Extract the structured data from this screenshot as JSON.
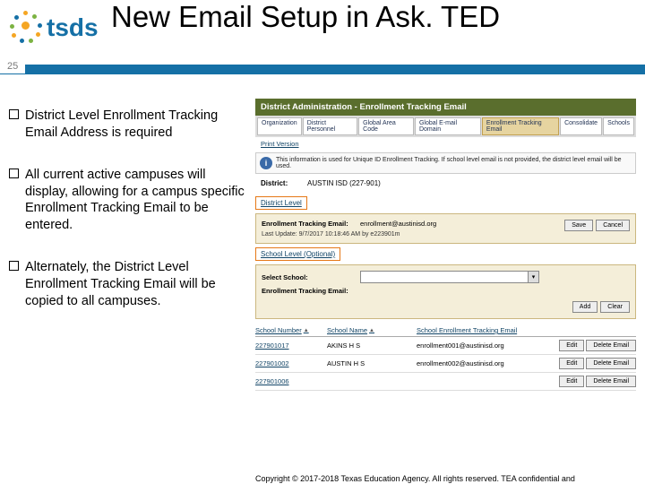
{
  "header": {
    "logo_text": "tsds",
    "title": "New Email Setup in Ask. TED",
    "slide_number": "25"
  },
  "bullets": [
    "District Level Enrollment Tracking Email Address is required",
    "All current active campuses will display, allowing for a campus specific Enrollment Tracking Email to be entered.",
    "Alternately, the District Level Enrollment Tracking Email will be copied to all campuses."
  ],
  "screenshot": {
    "window_title": "District Administration - Enrollment Tracking Email",
    "tabs": [
      "Organization",
      "District Personnel",
      "Global Area Code",
      "Global E-mail Domain",
      "Enrollment Tracking Email",
      "Consolidate",
      "Schools"
    ],
    "active_tab_index": 4,
    "print_link": "Print Version",
    "info_text": "This information is used for Unique ID Enrollment Tracking. If school level email is not provided, the district level email will be used.",
    "district_label": "District:",
    "district_value": "AUSTIN ISD (227-901)",
    "district_section": "District Level",
    "district_form": {
      "email_label": "Enrollment Tracking Email:",
      "email_value": "enrollment@austinisd.org",
      "save": "Save",
      "cancel": "Cancel",
      "updated": "Last Update: 9/7/2017 10:18:46 AM by e223901m"
    },
    "school_section": "School Level (Optional)",
    "school_form": {
      "select_label": "Select School:",
      "email_label": "Enrollment Tracking Email:",
      "add": "Add",
      "clear": "Clear"
    },
    "table": {
      "headers": [
        "School Number",
        "School Name",
        "School Enrollment Tracking Email"
      ],
      "rows": [
        {
          "num": "227901017",
          "name": "AKINS H S",
          "email": "enrollment001@austinisd.org"
        },
        {
          "num": "227901002",
          "name": "AUSTIN H S",
          "email": "enrollment002@austinisd.org"
        },
        {
          "num": "227901006",
          "name": "",
          "email": ""
        }
      ],
      "edit": "Edit",
      "delete": "Delete Email"
    }
  },
  "footer": "Copyright © 2017-2018 Texas Education Agency. All rights reserved. TEA confidential and"
}
